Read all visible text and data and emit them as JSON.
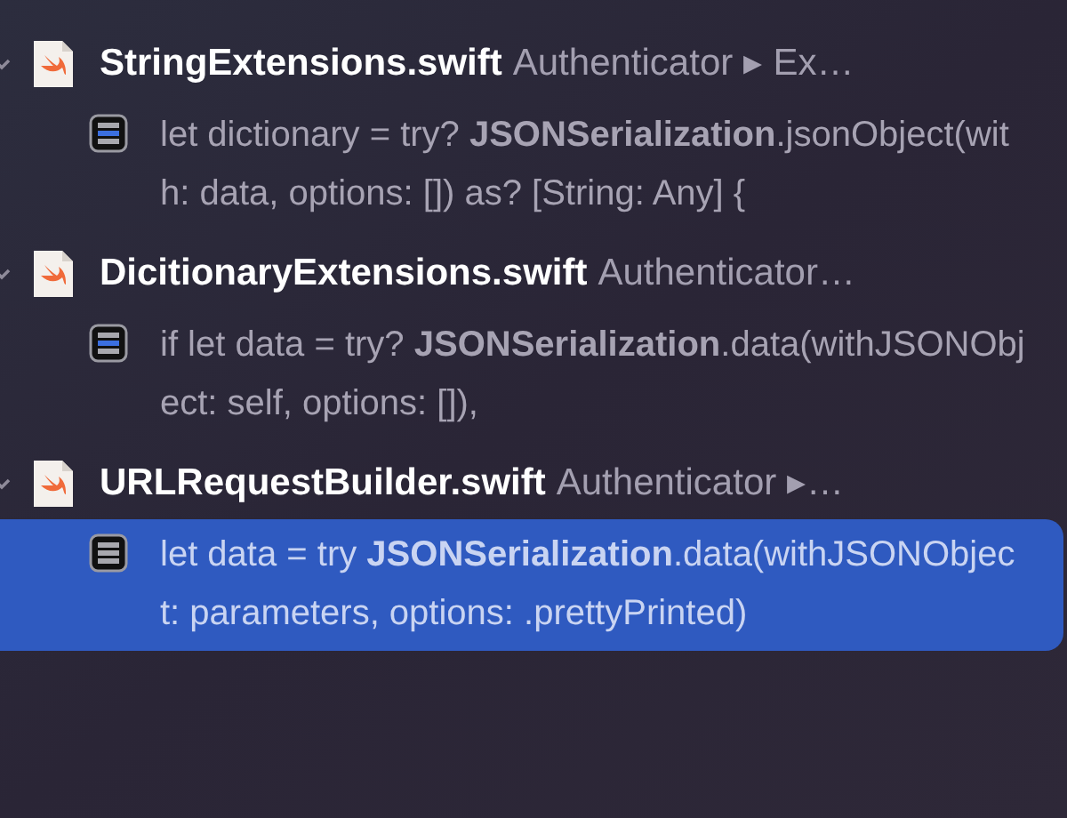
{
  "files": [
    {
      "name": "StringExtensions.swift",
      "path": "Authenticator ▸ Ex…",
      "expanded": true,
      "results": [
        {
          "text": "let dictionary = try? **JSONSerialization**.jsonObject(with: data, options: []) as? [String: Any] {",
          "selected": false
        }
      ]
    },
    {
      "name": "DicitionaryExtensions.swift",
      "path": "Authenticator…",
      "expanded": true,
      "results": [
        {
          "text": "if let data = try? **JSONSerialization**.data(withJSONObject: self, options: []),",
          "selected": false
        }
      ]
    },
    {
      "name": "URLRequestBuilder.swift",
      "path": "Authenticator ▸…",
      "expanded": true,
      "results": [
        {
          "text": "let data = try **JSONSerialization**.data(withJSONObject: parameters, options: .prettyPrinted)",
          "selected": true
        }
      ]
    }
  ]
}
